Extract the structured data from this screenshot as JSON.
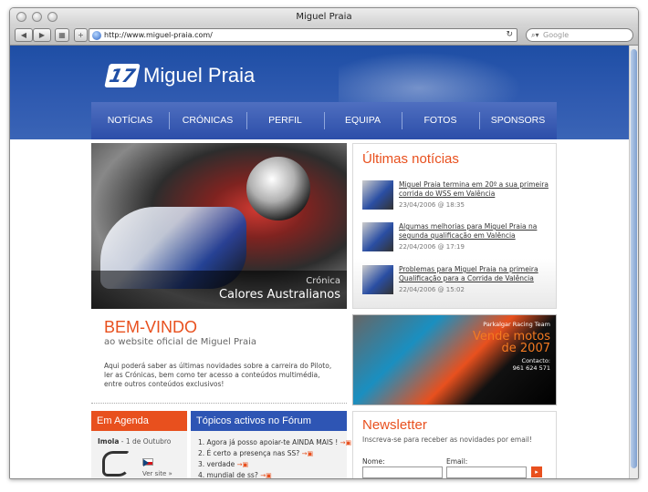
{
  "browser": {
    "title": "Miguel Praia",
    "url": "http://www.miguel-praia.com/",
    "search_placeholder": "Google"
  },
  "site": {
    "logo_number": "17",
    "logo_text": "Miguel Praia",
    "nav": [
      "NOTÍCIAS",
      "CRÓNICAS",
      "PERFIL",
      "EQUIPA",
      "FOTOS",
      "SPONSORS"
    ]
  },
  "hero": {
    "kicker": "Crónica",
    "title": "Calores Australianos"
  },
  "news": {
    "heading": "Últimas notícias",
    "items": [
      {
        "title": "Miguel Praia termina em 20º a sua primeira corrida do WSS em Valência",
        "date": "23/04/2006 @ 18:35"
      },
      {
        "title": "Algumas melhorias para Miguel Praia na segunda qualificação em Valência",
        "date": "22/04/2006 @ 17:19"
      },
      {
        "title": "Problemas para Miguel Praia na primeira Qualificação para a Corrida de Valência",
        "date": "22/04/2006 @ 15:02"
      }
    ]
  },
  "welcome": {
    "heading": "BEM-VINDO",
    "subtitle": "ao website oficial de Miguel Praia",
    "text": "Aqui poderá saber as últimas novidades sobre a carreira do Piloto, ler as Crónicas, bem como ter acesso a conteúdos multimédia, entre outros conteúdos exclusivos!"
  },
  "ad": {
    "team": "Parkalgar Racing Team",
    "headline_1": "Vende motos",
    "headline_2": "de 2007",
    "contact_label": "Contacto:",
    "contact_phone": "961 624 571"
  },
  "agenda": {
    "heading": "Em Agenda",
    "event_name": "Imola",
    "event_date": " - 1 de Outubro",
    "more": "Ver site »"
  },
  "forum": {
    "heading": "Tópicos activos no Fórum",
    "items": [
      "1. Agora já posso apoiar-te AINDA MAIS !",
      "2. É certo a presença nas SS?",
      "3. verdade",
      "4. mundial de ss?"
    ]
  },
  "newsletter": {
    "heading": "Newsletter",
    "text": "Inscreva-se para receber as novidades por email!",
    "name_label": "Nome:",
    "email_label": "Email:"
  }
}
